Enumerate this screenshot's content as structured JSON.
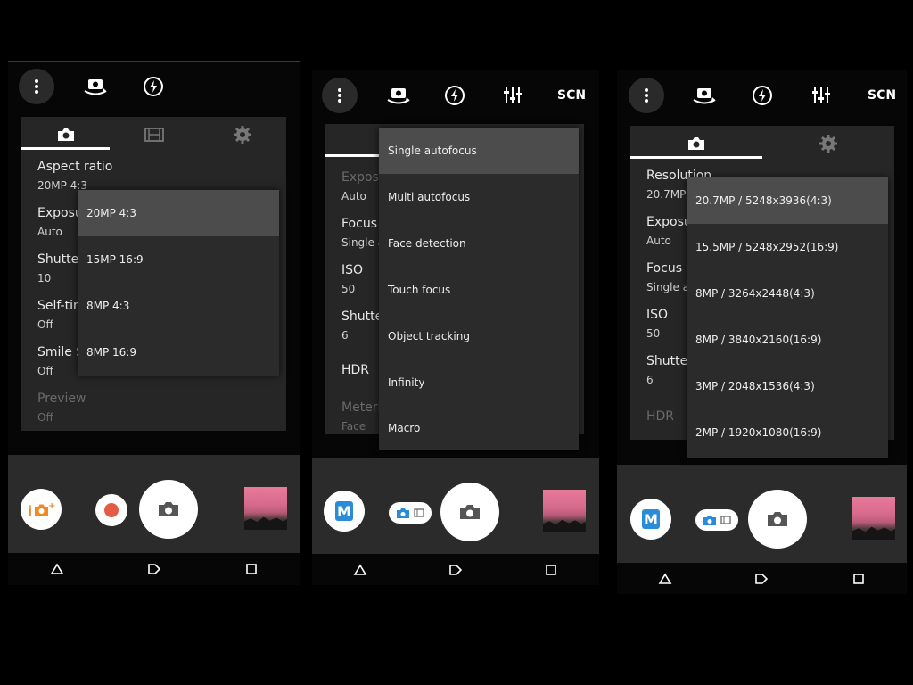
{
  "screen1": {
    "rows": [
      {
        "title": "Aspect ratio",
        "value": "20MP 4:3"
      },
      {
        "title": "Exposu",
        "value": "Auto"
      },
      {
        "title": "Shutte",
        "value": "10"
      },
      {
        "title": "Self-tim",
        "value": "Off"
      },
      {
        "title": "Smile S",
        "value": "Off"
      },
      {
        "title": "Preview",
        "value": "Off"
      }
    ],
    "dropdown": [
      "20MP 4:3",
      "15MP 16:9",
      "8MP 4:3",
      "8MP 16:9"
    ],
    "selected_index": 0
  },
  "screen2": {
    "scn_label": "SCN",
    "rows": [
      {
        "title": "Exposure Mode",
        "value": "Auto"
      },
      {
        "title": "Focus mode",
        "value": "Single a"
      },
      {
        "title": "ISO",
        "value": "50"
      },
      {
        "title": "Shutter Speed",
        "value": "6"
      },
      {
        "title": "HDR",
        "value": ""
      },
      {
        "title": "Metering",
        "value": "Face"
      }
    ],
    "dropdown": [
      "Single autofocus",
      "Multi autofocus",
      "Face detection",
      "Touch focus",
      "Object tracking",
      "Infinity",
      "Macro"
    ],
    "selected_index": 0,
    "mode_label": "M"
  },
  "screen3": {
    "scn_label": "SCN",
    "rows": [
      {
        "title": "Resolution",
        "value": "20.7MP"
      },
      {
        "title": "Exposure Mode",
        "value": "Auto"
      },
      {
        "title": "Focus mode",
        "value": "Single a"
      },
      {
        "title": "ISO",
        "value": "50"
      },
      {
        "title": "Shutter Speed",
        "value": "6"
      },
      {
        "title": "HDR",
        "value": ""
      }
    ],
    "dropdown": [
      "20.7MP / 5248x3936(4:3)",
      "15.5MP / 5248x2952(16:9)",
      "8MP / 3264x2448(4:3)",
      "8MP / 3840x2160(16:9)",
      "3MP / 2048x1536(4:3)",
      "2MP / 1920x1080(16:9)"
    ],
    "selected_index": 0,
    "mode_label": "M"
  },
  "icons": {
    "menu": "more-vert-icon",
    "switch_camera": "switch-camera-icon",
    "flash": "flash-auto-icon",
    "settings_sliders": "tune-icon",
    "photo_tab": "camera-icon",
    "video_tab": "film-icon",
    "settings_tab": "gear-icon"
  },
  "colors": {
    "accent_blue": "#2a8bd6",
    "record_red": "#e35c43",
    "orange_mode": "#f08a24"
  }
}
